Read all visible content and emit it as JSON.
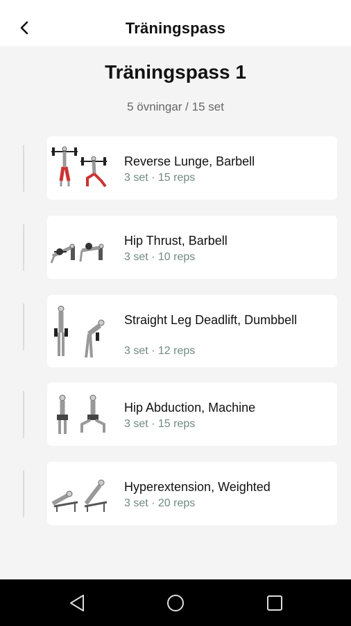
{
  "header": {
    "title": "Träningspass",
    "back_icon": "chevron-left-icon"
  },
  "workout": {
    "title": "Träningspass 1",
    "summary": "5 övningar / 15 set"
  },
  "exercises": [
    {
      "name": "Reverse Lunge, Barbell",
      "meta": "3 set · 15 reps",
      "icon": "barbell-lunge-illustration"
    },
    {
      "name": "Hip Thrust, Barbell",
      "meta": "3 set · 10 reps",
      "icon": "hip-thrust-illustration"
    },
    {
      "name": "Straight Leg Deadlift, Dumbbell",
      "meta": "3 set · 12 reps",
      "icon": "deadlift-illustration"
    },
    {
      "name": "Hip Abduction, Machine",
      "meta": "3 set · 15 reps",
      "icon": "hip-abduction-illustration"
    },
    {
      "name": "Hyperextension, Weighted",
      "meta": "3 set · 20 reps",
      "icon": "hyperextension-illustration"
    }
  ],
  "navbar": {
    "back_icon": "triangle-back-icon",
    "home_icon": "circle-home-icon",
    "recents_icon": "square-recents-icon"
  },
  "colors": {
    "meta_text": "#6f8a82",
    "background": "#f4f4f4",
    "card": "#ffffff",
    "navbar": "#000000"
  }
}
